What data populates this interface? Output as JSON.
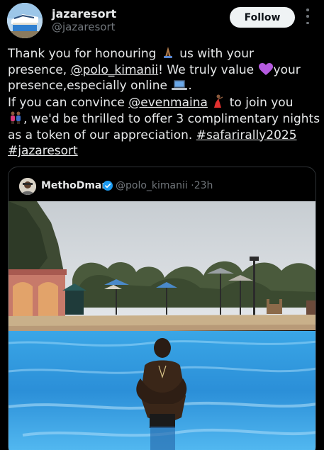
{
  "header": {
    "name": "jazaresort",
    "handle": "@jazaresort",
    "follow_label": "Follow"
  },
  "tweet": {
    "lines": [
      [
        "Thank you for honouring ",
        "[pray-emoji]",
        " us with your"
      ],
      [
        "presence, ",
        "@polo_kimanii",
        "! We truly value ",
        "[purple-heart-emoji]",
        "your"
      ],
      [
        "presence,especially online ",
        "[laptop-emoji]",
        "."
      ],
      [
        "If you can convince ",
        "@evenmaina",
        " ",
        "[dancer-emoji]",
        " to join you"
      ],
      [
        "[couple-emoji]",
        ", we'd be thrilled to offer 3 complimentary nights"
      ],
      [
        "as a token of our appreciation. ",
        "#safarirally2025"
      ],
      [
        "#jazaresort"
      ]
    ],
    "l1a": "Thank you for honouring",
    "l1b": "us with your",
    "l2a": "presence,",
    "l2mention": "@polo_kimanii",
    "l2b": "! We truly value",
    "l2c": "your",
    "l3a": "presence,especially online",
    "l3b": ".",
    "l4a": "If you can convince",
    "l4mention": "@evenmaina",
    "l4b": "to join you",
    "l5a": ", we'd be thrilled to offer 3 complimentary nights",
    "l6a": "as a token of our appreciation.",
    "l6tag": "#safarirally2025",
    "l7tag": "#jazaresort"
  },
  "quote": {
    "name": "MethoDman",
    "handle": "@polo_kimanii",
    "separator": "·",
    "time": "23h",
    "verified": true
  },
  "colors": {
    "background": "#000000",
    "text": "#e7e9ea",
    "muted": "#71767b",
    "border": "#2f3336",
    "verified": "#1d9bf0",
    "follow_bg": "#eff3f4"
  }
}
